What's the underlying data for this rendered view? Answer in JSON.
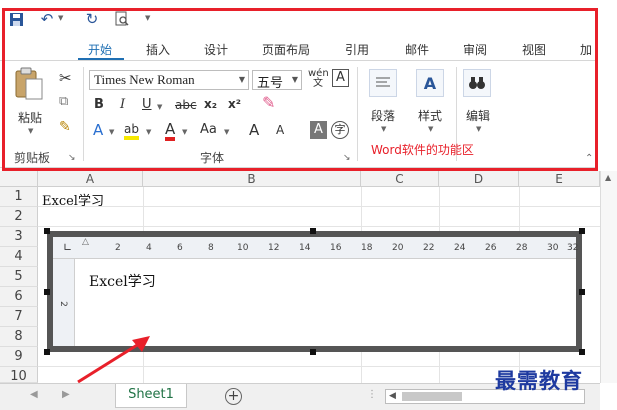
{
  "qat": {
    "save_icon": "save-icon",
    "undo_icon": "undo-icon",
    "redo_icon": "redo-icon",
    "preview_icon": "print-preview-icon"
  },
  "tabs": [
    "开始",
    "插入",
    "设计",
    "页面布局",
    "引用",
    "邮件",
    "审阅",
    "视图",
    "加"
  ],
  "ribbon": {
    "clipboard": {
      "paste_label": "粘贴",
      "group_label": "剪贴板"
    },
    "font": {
      "font_name": "Times New Roman",
      "font_size": "五号",
      "group_label": "字体",
      "bold": "B",
      "italic": "I",
      "underline": "U",
      "strike": "abc",
      "subscript": "x₂",
      "superscript": "x²",
      "text_effect": "A",
      "highlight": "ab",
      "font_color": "A",
      "change_case": "Aa",
      "grow": "A",
      "shrink": "A",
      "char_shading": "A",
      "enclose": "字",
      "phonetic": "wén 文",
      "char_border": "A"
    },
    "paragraph": {
      "label": "段落"
    },
    "styles": {
      "label": "样式"
    },
    "editing": {
      "label": "编辑"
    },
    "annotation": "Word软件的功能区"
  },
  "sheet": {
    "columns": [
      "A",
      "B",
      "C",
      "D",
      "E"
    ],
    "rows": [
      "1",
      "2",
      "3",
      "4",
      "5",
      "6",
      "7",
      "8",
      "9",
      "10"
    ],
    "cell_a1": "Excel学习"
  },
  "word_object": {
    "ruler_ticks": [
      "2",
      "4",
      "6",
      "8",
      "10",
      "12",
      "14",
      "16",
      "18",
      "20",
      "22",
      "24",
      "26",
      "28",
      "30",
      "32"
    ],
    "text": "Excel学习",
    "vruler_mark": "2"
  },
  "sheet_tabs": {
    "active": "Sheet1",
    "add_label": "+"
  },
  "watermark": "最需教育"
}
